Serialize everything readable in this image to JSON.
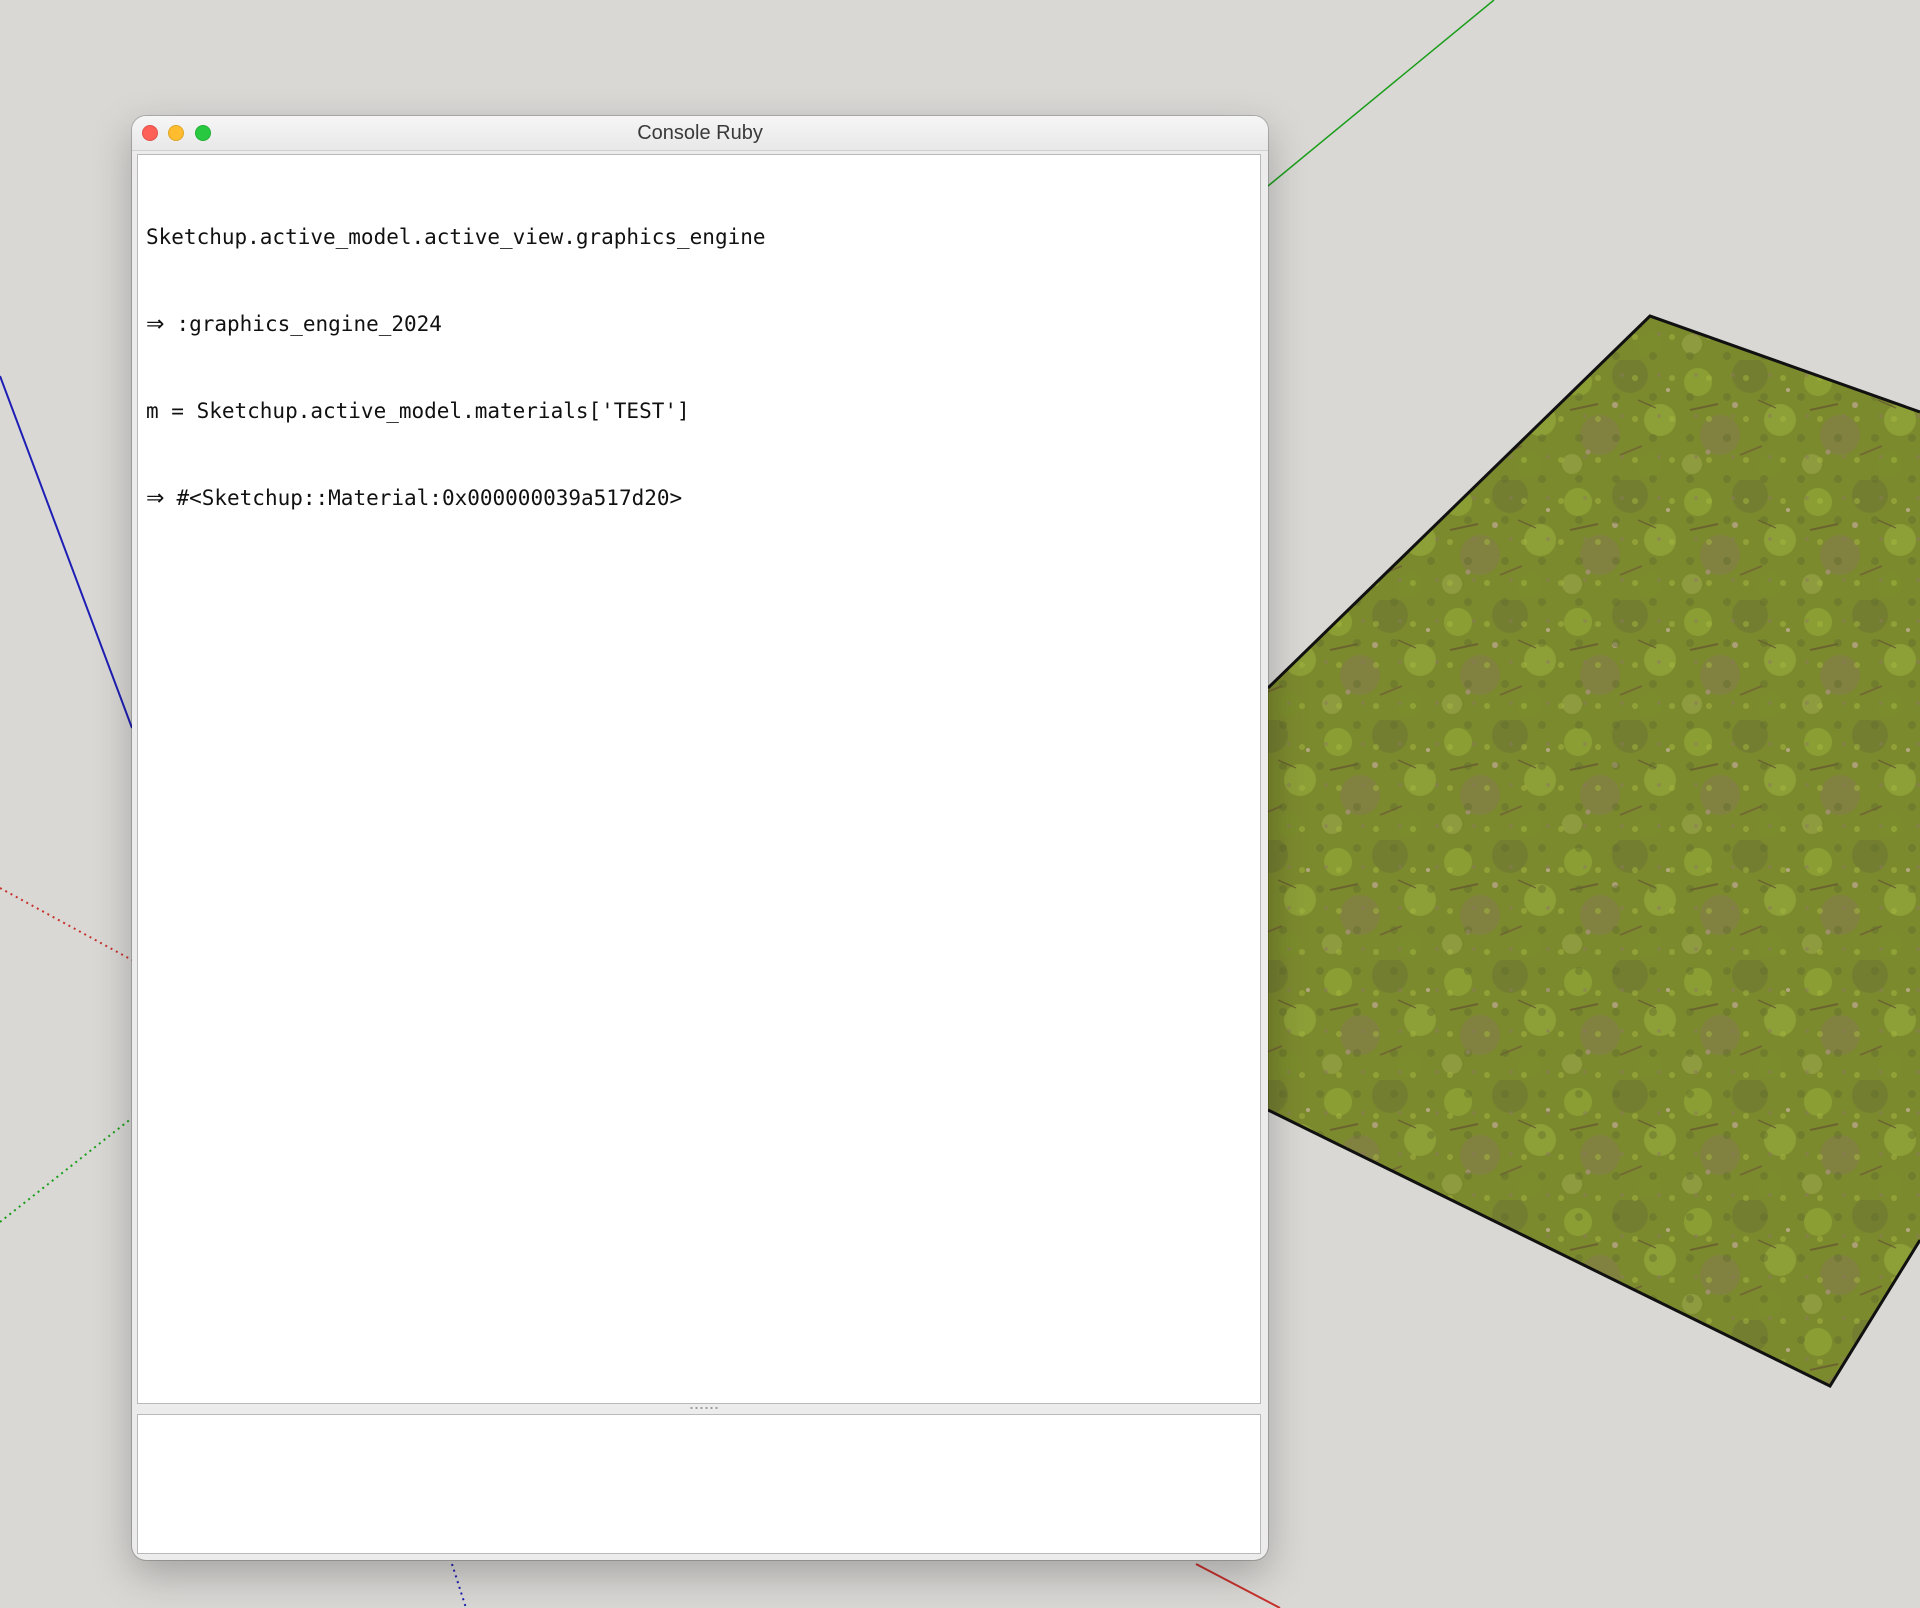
{
  "window": {
    "title": "Console Ruby"
  },
  "console": {
    "lines": [
      {
        "prefix": "",
        "text": "Sketchup.active_model.active_view.graphics_engine"
      },
      {
        "prefix": "⇒",
        "text": ":graphics_engine_2024"
      },
      {
        "prefix": "",
        "text": "m = Sketchup.active_model.materials['TEST']"
      },
      {
        "prefix": "⇒",
        "text": "#<Sketchup::Material:0x000000039a517d20>"
      }
    ],
    "input_value": ""
  },
  "scene": {
    "background_color": "#d9d8d5",
    "axis_colors": {
      "red": "#c8322d",
      "green": "#1a9e1a",
      "blue": "#1e1eb4"
    },
    "ground_texture": "grass-moss-texture"
  }
}
